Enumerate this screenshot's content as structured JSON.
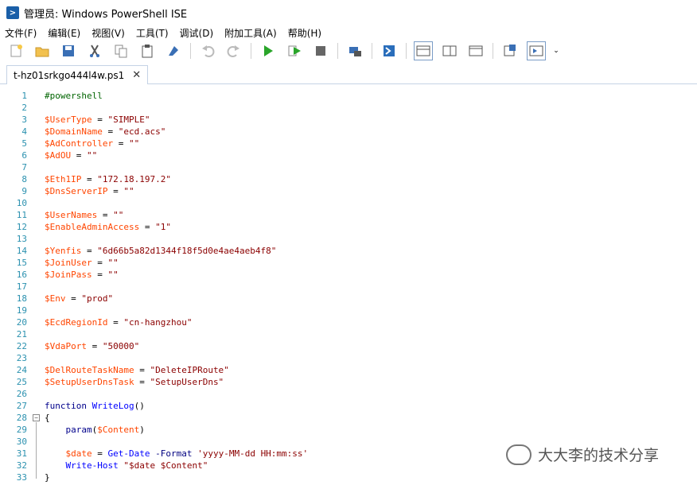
{
  "window": {
    "title": "管理员: Windows PowerShell ISE"
  },
  "menu": [
    "文件(F)",
    "编辑(E)",
    "视图(V)",
    "工具(T)",
    "调试(D)",
    "附加工具(A)",
    "帮助(H)"
  ],
  "toolbar": {
    "icons": [
      "new-icon",
      "open-icon",
      "save-icon",
      "cut-icon",
      "copy-icon",
      "paste-icon",
      "clear-icon",
      "undo-icon",
      "redo-icon",
      "run-icon",
      "run-selection-icon",
      "stop-icon",
      "remote-icon",
      "powershell-icon",
      "layout-top-icon",
      "layout-right-icon",
      "layout-max-icon",
      "show-commands-icon",
      "show-addon-icon",
      "overflow-icon"
    ]
  },
  "tab": {
    "label": "t-hz01srkgo444l4w.ps1",
    "close": "✕"
  },
  "code_lines": [
    {
      "n": "1",
      "parts": [
        [
          "cmt",
          "#powershell"
        ]
      ]
    },
    {
      "n": "2",
      "parts": []
    },
    {
      "n": "3",
      "parts": [
        [
          "var",
          "$UserType"
        ],
        [
          "plain",
          " = "
        ],
        [
          "str",
          "\"SIMPLE\""
        ]
      ]
    },
    {
      "n": "4",
      "parts": [
        [
          "var",
          "$DomainName"
        ],
        [
          "plain",
          " = "
        ],
        [
          "str",
          "\"ecd.acs\""
        ]
      ]
    },
    {
      "n": "5",
      "parts": [
        [
          "var",
          "$AdController"
        ],
        [
          "plain",
          " = "
        ],
        [
          "str",
          "\"\""
        ]
      ]
    },
    {
      "n": "6",
      "parts": [
        [
          "var",
          "$AdOU"
        ],
        [
          "plain",
          " = "
        ],
        [
          "str",
          "\"\""
        ]
      ]
    },
    {
      "n": "7",
      "parts": []
    },
    {
      "n": "8",
      "parts": [
        [
          "var",
          "$Eth1IP"
        ],
        [
          "plain",
          " = "
        ],
        [
          "str",
          "\"172.18.197.2\""
        ]
      ]
    },
    {
      "n": "9",
      "parts": [
        [
          "var",
          "$DnsServerIP"
        ],
        [
          "plain",
          " = "
        ],
        [
          "str",
          "\"\""
        ]
      ]
    },
    {
      "n": "10",
      "parts": []
    },
    {
      "n": "11",
      "parts": [
        [
          "var",
          "$UserNames"
        ],
        [
          "plain",
          " = "
        ],
        [
          "str",
          "\"\""
        ]
      ]
    },
    {
      "n": "12",
      "parts": [
        [
          "var",
          "$EnableAdminAccess"
        ],
        [
          "plain",
          " = "
        ],
        [
          "str",
          "\"1\""
        ]
      ]
    },
    {
      "n": "13",
      "parts": []
    },
    {
      "n": "14",
      "parts": [
        [
          "var",
          "$Yenfis"
        ],
        [
          "plain",
          " = "
        ],
        [
          "str",
          "\"6d66b5a82d1344f18f5d0e4ae4aeb4f8\""
        ]
      ]
    },
    {
      "n": "15",
      "parts": [
        [
          "var",
          "$JoinUser"
        ],
        [
          "plain",
          " = "
        ],
        [
          "str",
          "\"\""
        ]
      ]
    },
    {
      "n": "16",
      "parts": [
        [
          "var",
          "$JoinPass"
        ],
        [
          "plain",
          " = "
        ],
        [
          "str",
          "\"\""
        ]
      ]
    },
    {
      "n": "17",
      "parts": []
    },
    {
      "n": "18",
      "parts": [
        [
          "var",
          "$Env"
        ],
        [
          "plain",
          " = "
        ],
        [
          "str",
          "\"prod\""
        ]
      ]
    },
    {
      "n": "19",
      "parts": []
    },
    {
      "n": "20",
      "parts": [
        [
          "var",
          "$EcdRegionId"
        ],
        [
          "plain",
          " = "
        ],
        [
          "str",
          "\"cn-hangzhou\""
        ]
      ]
    },
    {
      "n": "21",
      "parts": []
    },
    {
      "n": "22",
      "parts": [
        [
          "var",
          "$VdaPort"
        ],
        [
          "plain",
          " = "
        ],
        [
          "str",
          "\"50000\""
        ]
      ]
    },
    {
      "n": "23",
      "parts": []
    },
    {
      "n": "24",
      "parts": [
        [
          "var",
          "$DelRouteTaskName"
        ],
        [
          "plain",
          " = "
        ],
        [
          "str",
          "\"DeleteIPRoute\""
        ]
      ]
    },
    {
      "n": "25",
      "parts": [
        [
          "var",
          "$SetupUserDnsTask"
        ],
        [
          "plain",
          " = "
        ],
        [
          "str",
          "\"SetupUserDns\""
        ]
      ]
    },
    {
      "n": "26",
      "parts": []
    },
    {
      "n": "27",
      "parts": [
        [
          "kw",
          "function "
        ],
        [
          "cmd",
          "WriteLog"
        ],
        [
          "plain",
          "()"
        ]
      ]
    },
    {
      "n": "28",
      "parts": [
        [
          "plain",
          "{"
        ]
      ]
    },
    {
      "n": "29",
      "parts": [
        [
          "plain",
          "    "
        ],
        [
          "kw",
          "param"
        ],
        [
          "plain",
          "("
        ],
        [
          "var",
          "$Content"
        ],
        [
          "plain",
          ")"
        ]
      ]
    },
    {
      "n": "30",
      "parts": []
    },
    {
      "n": "31",
      "parts": [
        [
          "plain",
          "    "
        ],
        [
          "var",
          "$date"
        ],
        [
          "plain",
          " = "
        ],
        [
          "cmd",
          "Get-Date"
        ],
        [
          "plain",
          " "
        ],
        [
          "param",
          "-Format"
        ],
        [
          "plain",
          " "
        ],
        [
          "str",
          "'yyyy-MM-dd HH:mm:ss'"
        ]
      ]
    },
    {
      "n": "32",
      "parts": [
        [
          "plain",
          "    "
        ],
        [
          "cmd",
          "Write-Host"
        ],
        [
          "plain",
          " "
        ],
        [
          "str",
          "\"$date $Content\""
        ]
      ]
    },
    {
      "n": "33",
      "parts": [
        [
          "plain",
          "}"
        ]
      ]
    }
  ],
  "watermark": {
    "text": "大大李的技术分享"
  }
}
